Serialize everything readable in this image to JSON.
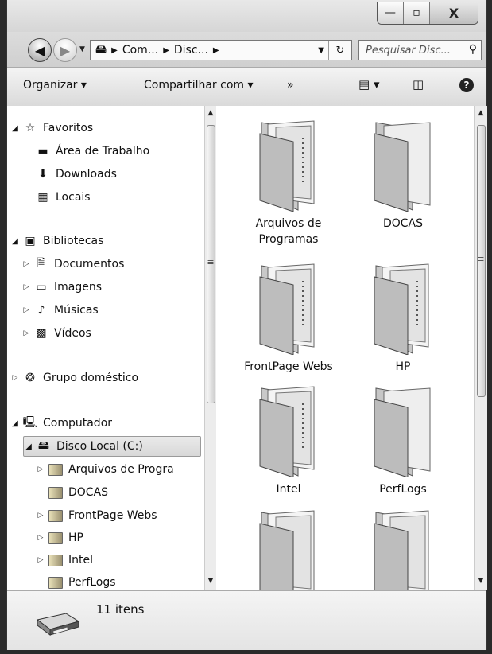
{
  "window_controls": {
    "minimize": "—",
    "maximize": "▫",
    "close": "X"
  },
  "address": {
    "segments": [
      "Com...",
      "Disc..."
    ],
    "refresh": "↻"
  },
  "search": {
    "placeholder": "Pesquisar Disc..."
  },
  "toolbar": {
    "organize": "Organizar",
    "share": "Compartilhar com",
    "more": "»",
    "help": "?"
  },
  "nav": {
    "favorites": {
      "label": "Favoritos",
      "items": [
        "Área de Trabalho",
        "Downloads",
        "Locais"
      ]
    },
    "libraries": {
      "label": "Bibliotecas",
      "items": [
        "Documentos",
        "Imagens",
        "Músicas",
        "Vídeos"
      ]
    },
    "homegroup": {
      "label": "Grupo doméstico"
    },
    "computer": {
      "label": "Computador",
      "drive": "Disco Local (C:)",
      "folders": [
        "Arquivos de Progra",
        "DOCAS",
        "FrontPage Webs",
        "HP",
        "Intel",
        "PerfLogs"
      ]
    }
  },
  "content": {
    "folders": [
      {
        "name_line1": "Arquivos de",
        "name_line2": "Programas"
      },
      {
        "name_line1": "DOCAS",
        "name_line2": ""
      },
      {
        "name_line1": "FrontPage Webs",
        "name_line2": ""
      },
      {
        "name_line1": "HP",
        "name_line2": ""
      },
      {
        "name_line1": "Intel",
        "name_line2": ""
      },
      {
        "name_line1": "PerfLogs",
        "name_line2": ""
      }
    ]
  },
  "status": {
    "item_count": "11 itens"
  }
}
